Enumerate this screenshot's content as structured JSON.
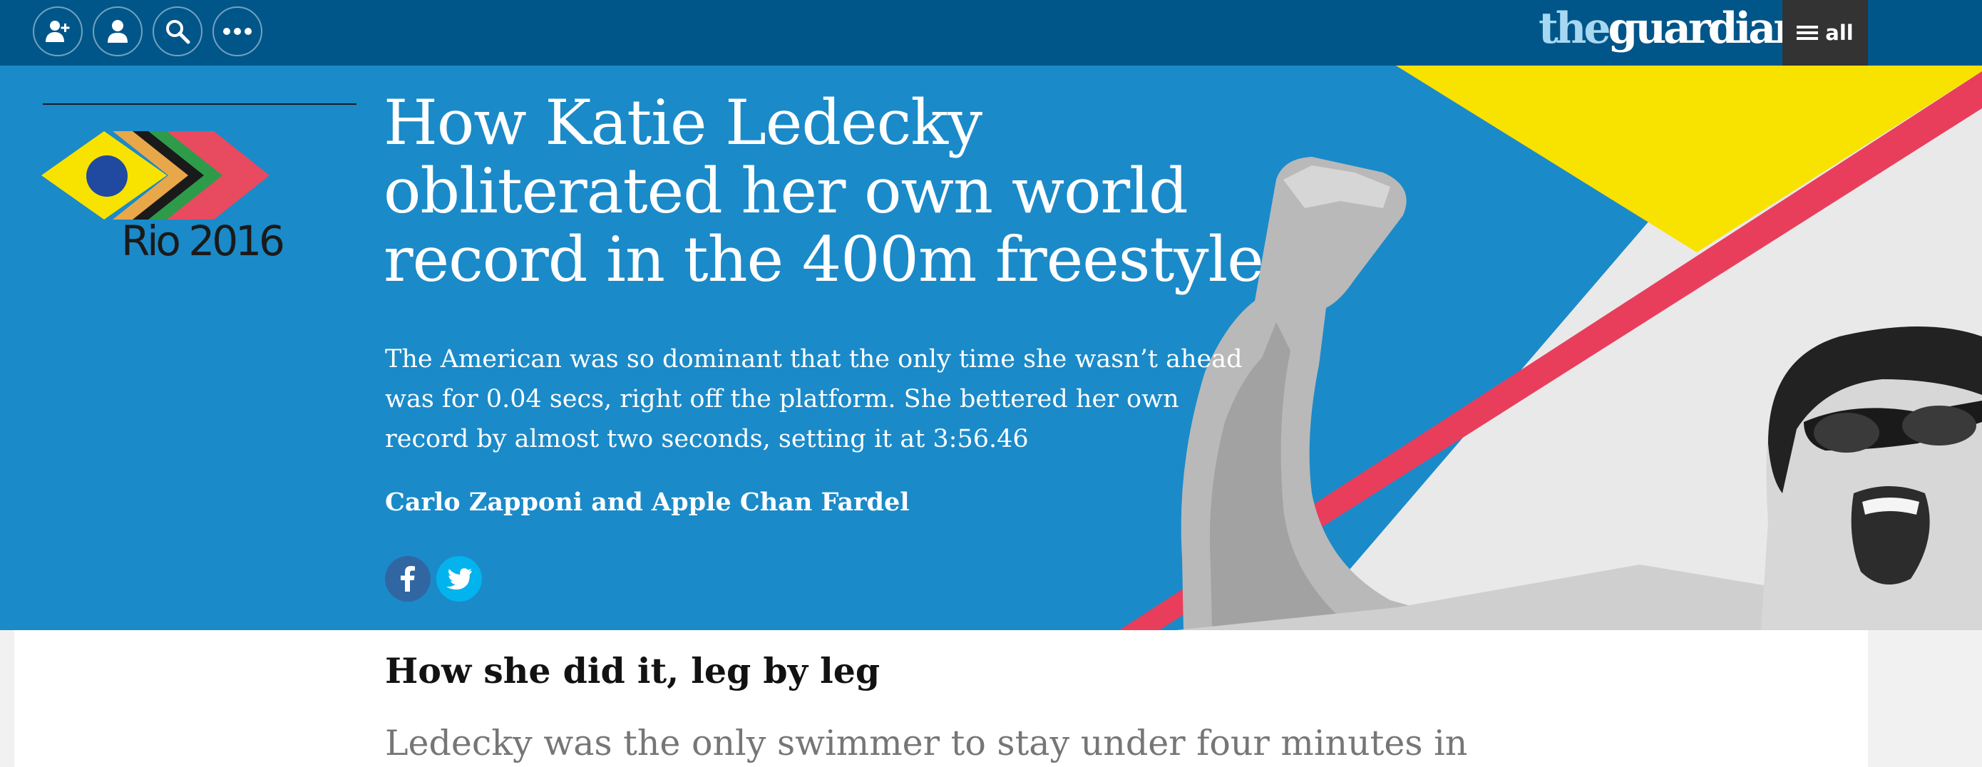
{
  "nav": {
    "buttons": [
      {
        "icon": "add-user-icon",
        "name": "sign-up-button"
      },
      {
        "icon": "user-icon",
        "name": "profile-button"
      },
      {
        "icon": "search-icon",
        "name": "search-button"
      },
      {
        "icon": "more-icon",
        "name": "more-button"
      }
    ],
    "logo_the": "the",
    "logo_guardian": "guardian",
    "all_label": "all"
  },
  "hero": {
    "logo_text": "Rio 2016",
    "headline": "How Katie Ledecky obliterated her own world record in the 400m freestyle",
    "standfirst": "The American was so dominant that the only time she wasn’t ahead was for 0.04 secs, right off the platform. She bettered her own record by almost two seconds, setting it at 3:56.46",
    "byline": "Carlo Zapponi and Apple Chan Fardel",
    "share": [
      {
        "icon": "facebook-icon",
        "name": "share-facebook-button"
      },
      {
        "icon": "twitter-icon",
        "name": "share-twitter-button"
      }
    ]
  },
  "article": {
    "section_heading": "How she did it, leg by leg",
    "body_text": "Ledecky was the only swimmer to stay under four minutes in"
  },
  "colors": {
    "nav_bg": "#005689",
    "hero_bg": "#1b8ac8",
    "accent_yellow": "#f8e200",
    "accent_pink": "#e83e5c",
    "logo_the": "#a7d8f2"
  }
}
